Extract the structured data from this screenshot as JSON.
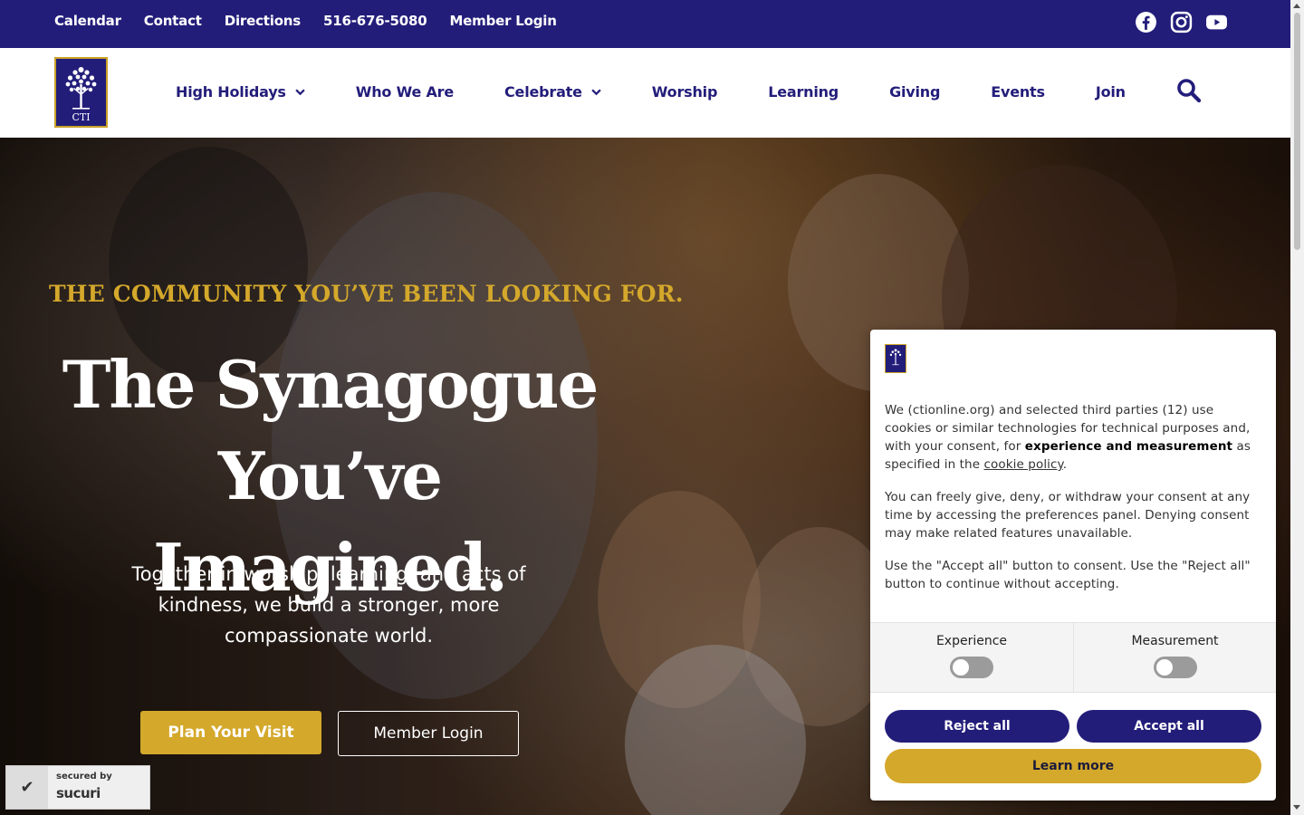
{
  "topbar": {
    "links": [
      "Calendar",
      "Contact",
      "Directions",
      "516-676-5080",
      "Member Login"
    ],
    "social": [
      "facebook-icon",
      "instagram-icon",
      "youtube-icon"
    ]
  },
  "nav": {
    "logo_text": "CTI",
    "items": [
      {
        "label": "High Holidays",
        "dropdown": true
      },
      {
        "label": "Who We Are",
        "dropdown": false
      },
      {
        "label": "Celebrate",
        "dropdown": true
      },
      {
        "label": "Worship",
        "dropdown": false
      },
      {
        "label": "Learning",
        "dropdown": false
      },
      {
        "label": "Giving",
        "dropdown": false
      },
      {
        "label": "Events",
        "dropdown": false
      },
      {
        "label": "Join",
        "dropdown": false
      }
    ]
  },
  "hero": {
    "tagline": "THE COMMUNITY YOU’VE BEEN LOOKING FOR.",
    "title_line1": "The Synagogue",
    "title_line2": "You’ve Imagined.",
    "subtitle": "Together in worship, learning, and acts of kindness, we build a stronger, more compassionate world.",
    "btn_visit": "Plan Your Visit",
    "btn_login": "Member Login"
  },
  "sucuri": {
    "line1": "secured by",
    "line2": "sucuri"
  },
  "cookie": {
    "p1_before": "We (ctionline.org) and selected third parties (12) use cookies or similar technologies for technical purposes and, with your consent, for ",
    "p1_bold": "experience and measurement",
    "p1_mid": " as specified in the ",
    "p1_link": "cookie policy",
    "p1_after": ".",
    "p2": "You can freely give, deny, or withdraw your consent at any time by accessing the preferences panel. Denying consent may make related features unavailable.",
    "p3": "Use the \"Accept all\" button to consent. Use the \"Reject all\" button to continue without accepting.",
    "toggle_experience": "Experience",
    "toggle_measurement": "Measurement",
    "btn_reject": "Reject all",
    "btn_accept": "Accept all",
    "btn_learn": "Learn more"
  },
  "colors": {
    "brand_navy": "#231d7a",
    "brand_gold": "#d4a82b"
  }
}
